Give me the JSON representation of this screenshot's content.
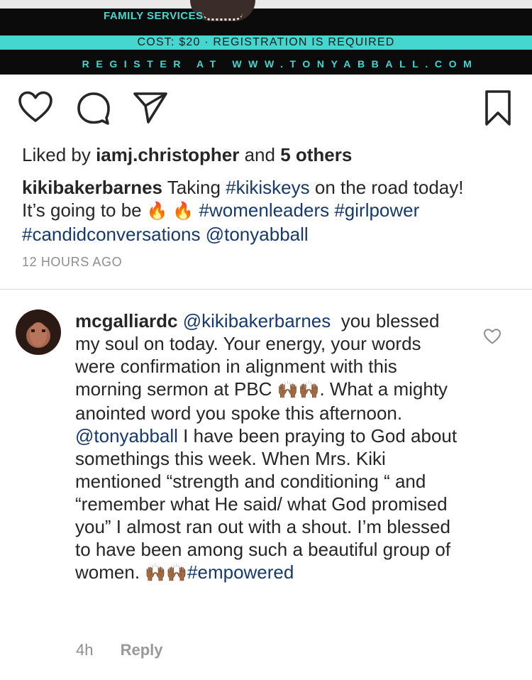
{
  "banner": {
    "family_services": "FAMILY SERVICES",
    "cost_line": "COST: $20 · REGISTRATION IS REQUIRED",
    "register_line": "REGISTER AT WWW.TONYABBALL.COM",
    "accent_color": "#45d6d0"
  },
  "actions": {
    "like_icon": "heart-outline-icon",
    "comment_icon": "comment-bubble-icon",
    "share_icon": "paper-plane-icon",
    "save_icon": "bookmark-icon"
  },
  "likes": {
    "prefix": "Liked by ",
    "user": "iamj.christopher",
    "middle": " and ",
    "others": "5 others"
  },
  "caption": {
    "username": "kikibakerbarnes",
    "text_1": "Taking ",
    "hashtag_1": "#kikiskeys",
    "text_2": " on the road today! It’s going to be ",
    "emoji_fire": "🔥 🔥",
    "hashtag_2": "#womenleaders",
    "hashtag_3": "#girlpower",
    "hashtag_4": "#candidconversations",
    "mention": "@tonyabball"
  },
  "timestamp": "12 HOURS AGO",
  "comment": {
    "username": "mcgalliardc",
    "mention_1": "@kikibakerbarnes",
    "text_1": "you blessed my soul on today. Your energy, your words were confirmation in alignment with this morning sermon at PBC ",
    "emoji_1": "🙌🏾🙌🏾",
    "text_2": ". What  a mighty anointed word you spoke this afternoon. ",
    "mention_2": "@tonyabball",
    "text_3": " I have been praying to God about somethings this week. When Mrs. Kiki mentioned “strength and conditioning “ and “remember what He said/ what God promised you” I almost ran out with a shout. I’m blessed to have been among such a beautiful group of women. ",
    "emoji_2": "🙌🏾🙌🏾",
    "hashtag": "#empowered",
    "age": "4h",
    "reply_label": "Reply"
  },
  "colors": {
    "link": "#17396b",
    "muted": "#8e8e8e",
    "divider": "#dbdbdb"
  }
}
